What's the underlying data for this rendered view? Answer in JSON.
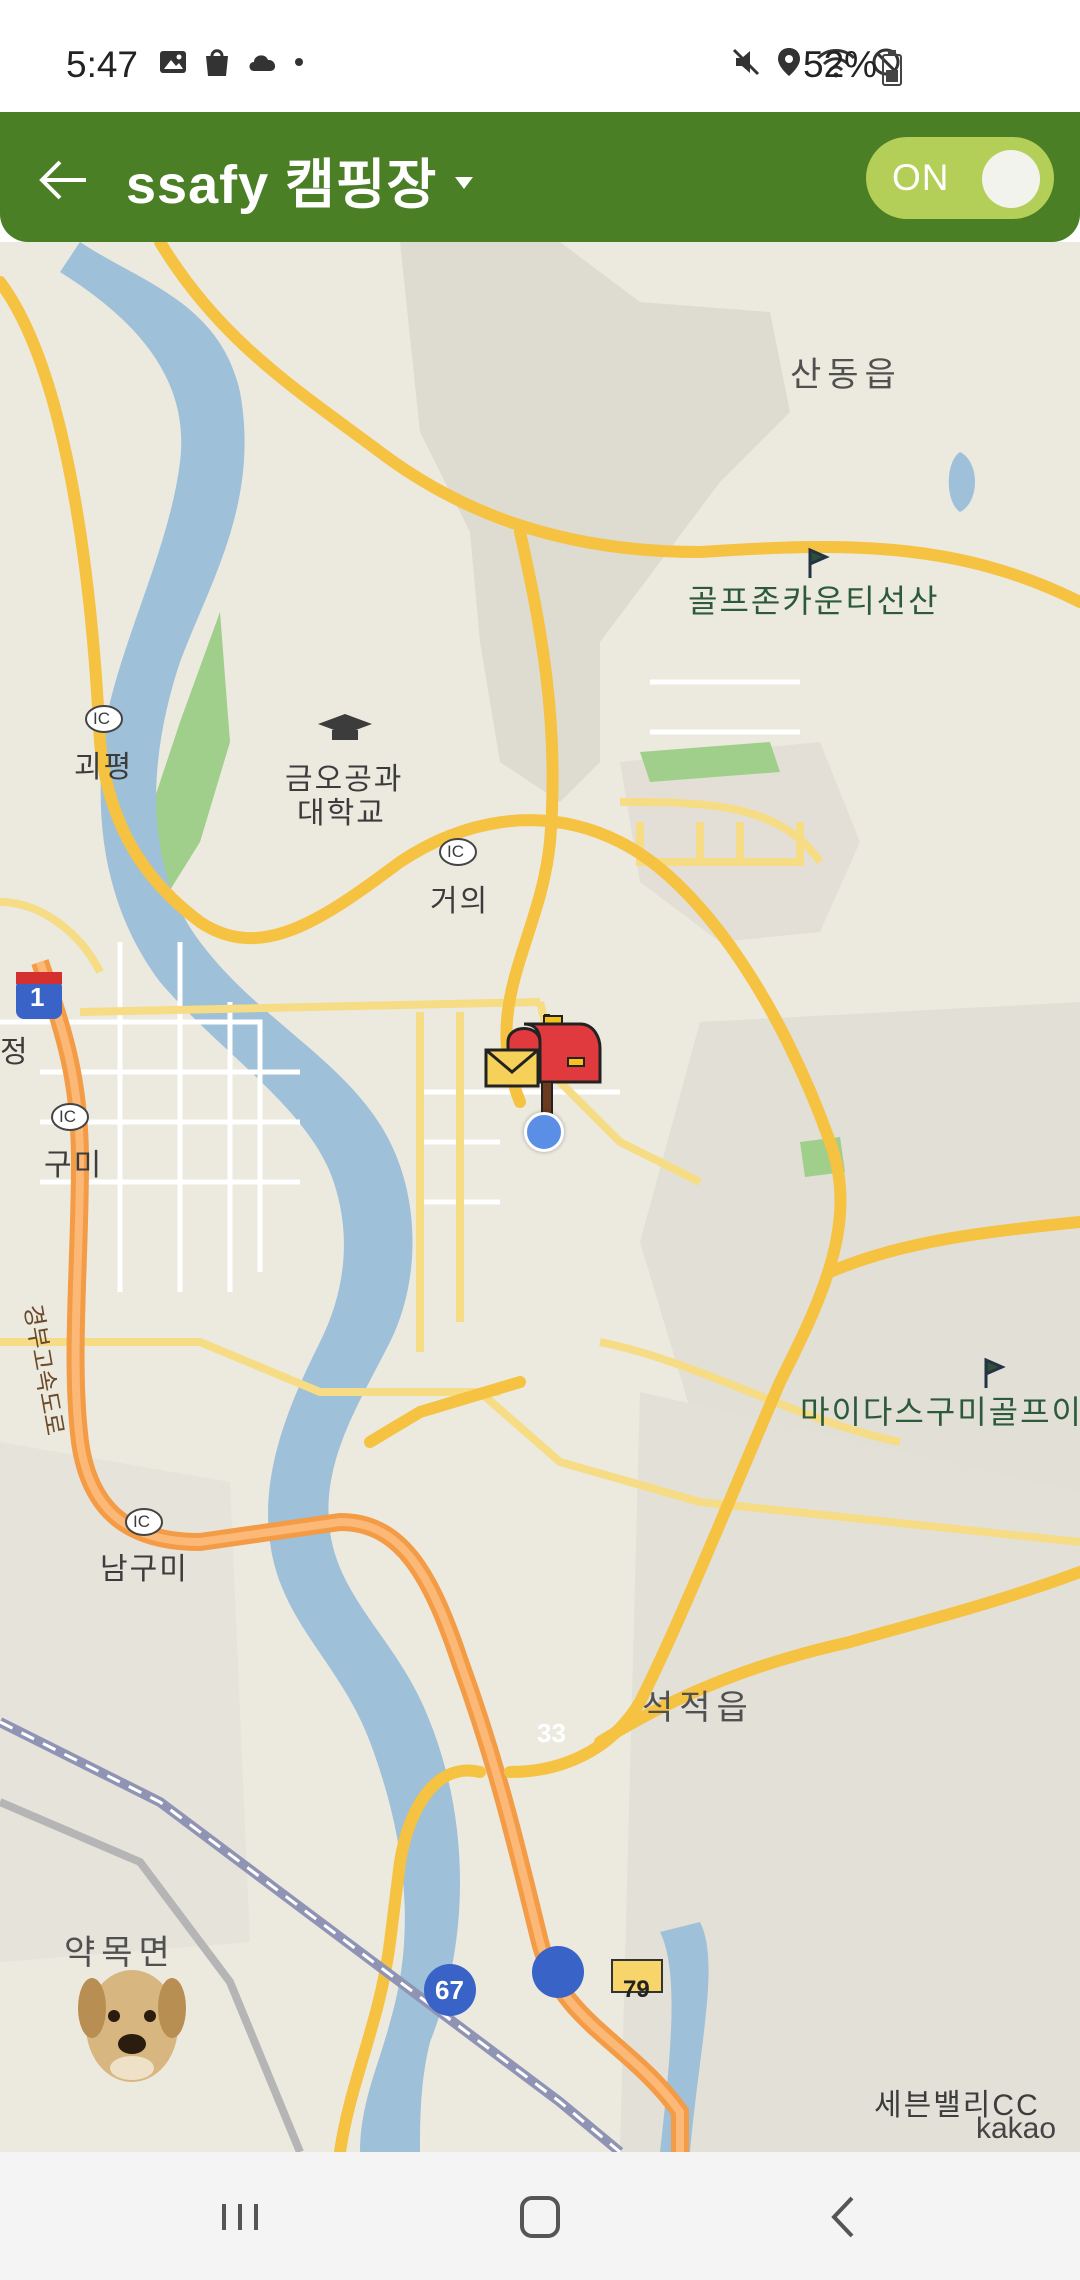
{
  "status_bar": {
    "time": "5:47",
    "battery": "52%",
    "icons": [
      "image-icon",
      "bag-icon",
      "cloud-icon",
      "dot-icon",
      "mute-icon",
      "location-icon",
      "wifi-icon",
      "block-icon",
      "battery-icon"
    ]
  },
  "header": {
    "title": "ssafy 캠핑장",
    "toggle_label": "ON",
    "toggle_on": true,
    "bg_color": "#4a7f25",
    "toggle_color": "#b4cf57"
  },
  "map": {
    "labels": {
      "sandong": "산동읍",
      "golfzone": "골프존카운티선산",
      "geumo": "금오공과",
      "geumo2": "대학교",
      "goepyeong": "괴평",
      "geoui": "거의",
      "gumi": "구미",
      "madaeda": "마이다스구미골프이",
      "gyeongbu": "경부고속도로",
      "namgumi": "남구미",
      "seokjeok": "석적읍",
      "yakmok": "약목면",
      "sebel": "세븐밸리CC",
      "jeong": "정"
    },
    "shields": {
      "r1": "1",
      "r33": "33",
      "r67": "67",
      "r79": "79",
      "ic": "IC"
    },
    "attribution": "kakao"
  },
  "fab": {
    "icon": "plus-icon",
    "color": "#a7cc45"
  },
  "nav": {
    "icons": [
      "recent-apps-icon",
      "home-icon",
      "back-icon"
    ]
  }
}
